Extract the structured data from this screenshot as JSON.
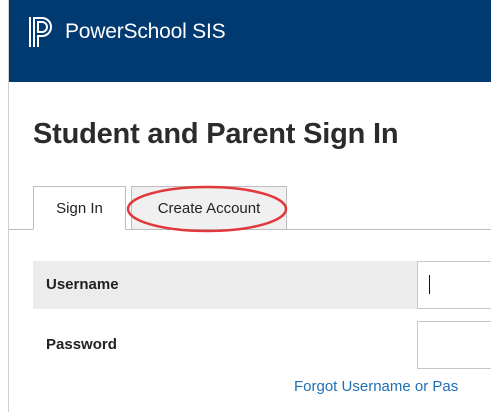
{
  "header": {
    "brand": "PowerSchool SIS",
    "logo_icon": "powerschool-logo-icon",
    "bg_color": "#003a70"
  },
  "main": {
    "title": "Student and Parent Sign In",
    "tabs": [
      {
        "label": "Sign In",
        "active": true
      },
      {
        "label": "Create Account",
        "active": false,
        "highlighted": true
      }
    ],
    "highlight_color": "#e0383b",
    "form": {
      "username_label": "Username",
      "username_value": "",
      "password_label": "Password",
      "password_value": "",
      "forgot_link": "Forgot Username or Pas"
    }
  }
}
